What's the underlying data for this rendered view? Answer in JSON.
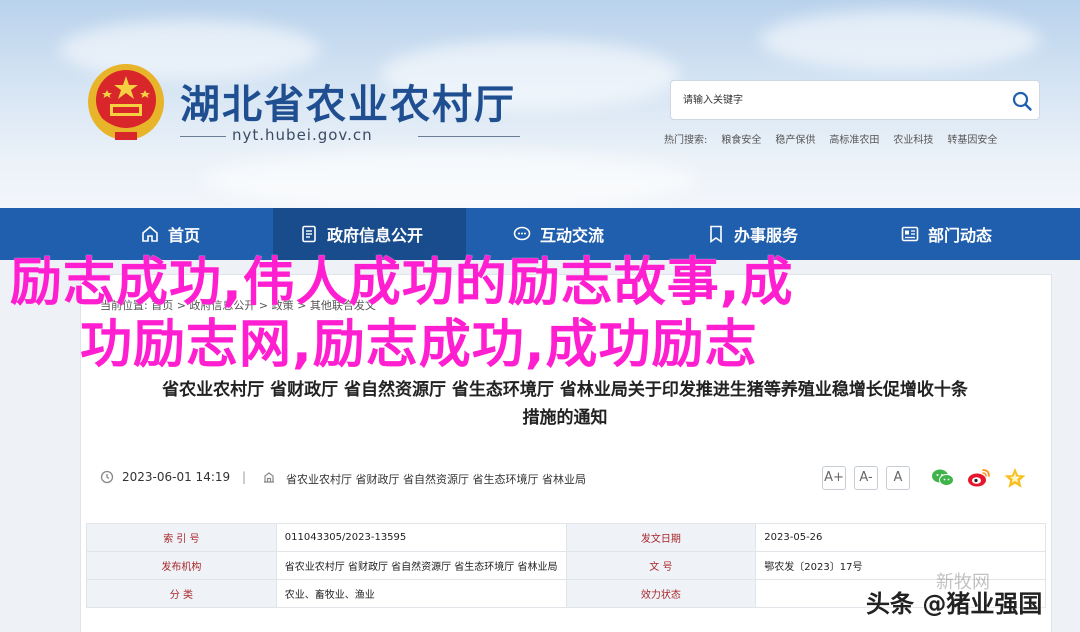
{
  "header": {
    "site_title": "湖北省农业农村厅",
    "site_domain": "nyt.hubei.gov.cn",
    "search_placeholder": "请输入关键字",
    "hot_search_label": "热门搜索:",
    "hot_search_items": [
      "粮食安全",
      "稳产保供",
      "高标准农田",
      "农业科技",
      "转基因安全"
    ]
  },
  "nav": {
    "items": [
      {
        "label": "首页",
        "icon": "home-icon"
      },
      {
        "label": "政府信息公开",
        "icon": "document-icon"
      },
      {
        "label": "互动交流",
        "icon": "chat-icon"
      },
      {
        "label": "办事服务",
        "icon": "bookmark-icon"
      },
      {
        "label": "部门动态",
        "icon": "news-icon"
      }
    ]
  },
  "breadcrumb": "当前位置: 首页 > 政府信息公开 > 政策 > 其他联合发文",
  "article": {
    "title_line1": "省农业农村厅 省财政厅 省自然资源厅 省生态环境厅 省林业局关于印发推进生猪等养殖业稳增长促增收十条",
    "title_line2": "措施的通知",
    "date": "2023-06-01 14:19",
    "separator": "|",
    "sources": "省农业农村厅 省财政厅 省自然资源厅 省生态环境厅 省林业局",
    "font_sizes": [
      "A+",
      "A-",
      "A"
    ]
  },
  "info_table": [
    {
      "l1": "索 引 号",
      "v1": "011043305/2023-13595",
      "l2": "发文日期",
      "v2": "2023-05-26"
    },
    {
      "l1": "发布机构",
      "v1": "省农业农村厅 省财政厅 省自然资源厅 省生态环境厅 省林业局",
      "l2": "文 号",
      "v2": "鄂农发〔2023〕17号"
    },
    {
      "l1": "分 类",
      "v1": "农业、畜牧业、渔业",
      "l2": "效力状态",
      "v2": ""
    }
  ],
  "overlay": {
    "line1": "励志成功,伟人成功的励志故事,成",
    "line2": "功励志网,励志成功,成功励志"
  },
  "watermark": "头条 @猪业强国",
  "watermark_ghost": "新牧网",
  "colors": {
    "nav_bg": "#1f5fad",
    "title_blue": "#1f4f91",
    "overlay_magenta": "#ff1fd0",
    "label_red": "#a8262a"
  }
}
